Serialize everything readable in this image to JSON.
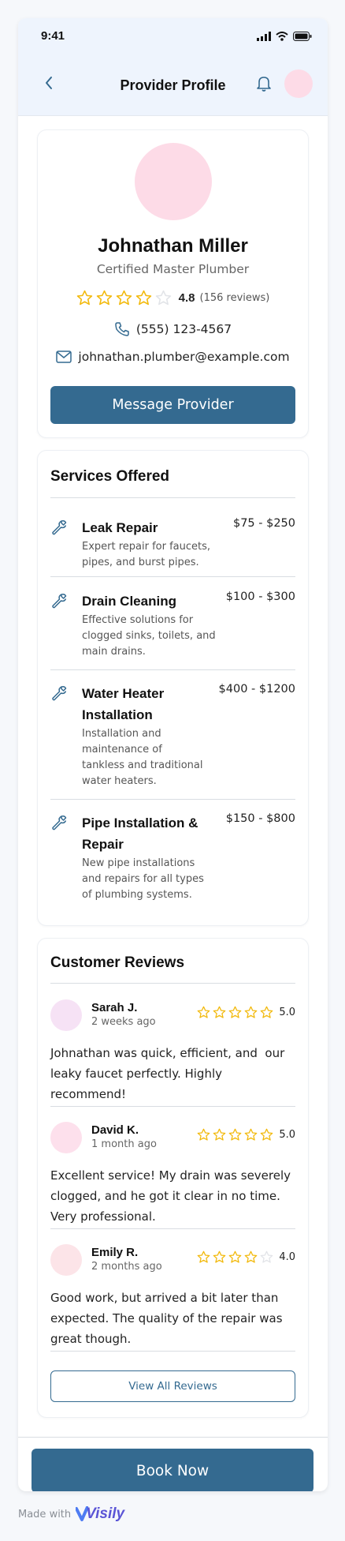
{
  "status_bar": {
    "time": "9:41"
  },
  "header": {
    "title": "Provider Profile"
  },
  "profile": {
    "name": "Johnathan Miller",
    "title": "Certified Master Plumber",
    "rating": "4.8",
    "rating_value": 4,
    "reviews_count": "(156 reviews)",
    "phone": "(555) 123-4567",
    "email": "johnathan.plumber@example.com",
    "message_label": "Message Provider"
  },
  "services": {
    "title": "Services Offered",
    "items": [
      {
        "name_lines": [
          "Leak Repair"
        ],
        "desc_lines": [
          "Expert repair for faucets,",
          "pipes, and burst pipes."
        ],
        "price": "$75 - $250"
      },
      {
        "name_lines": [
          "Drain Cleaning"
        ],
        "desc_lines": [
          "Effective solutions for",
          "clogged sinks, toilets, and",
          "main drains."
        ],
        "price": "$100 - $300"
      },
      {
        "name_lines": [
          "Water Heater",
          "Installation"
        ],
        "desc_lines": [
          "Installation and",
          "maintenance of",
          "tankless and traditional",
          "water heaters."
        ],
        "price": "$400 - $1200"
      },
      {
        "name_lines": [
          "Pipe Installation &",
          "Repair"
        ],
        "desc_lines": [
          "New pipe installations",
          "and repairs for all types",
          "of plumbing systems."
        ],
        "price": "$150 - $800"
      }
    ]
  },
  "reviews": {
    "title": "Customer Reviews",
    "view_all_label": "View All Reviews",
    "items": [
      {
        "name": "Sarah J.",
        "date": "2 weeks ago",
        "score": "5.0",
        "stars": 5,
        "avatar_color": "#f6e2f5",
        "text_lines": [
          "Johnathan was quick, efficient, and  our",
          "leaky faucet perfectly. Highly",
          "recommend!"
        ]
      },
      {
        "name": "David K.",
        "date": "1 month ago",
        "score": "5.0",
        "stars": 5,
        "avatar_color": "#fde0ec",
        "text_lines": [
          "Excellent service! My drain was severely",
          "clogged, and he got it clear in no time.",
          "Very professional."
        ]
      },
      {
        "name": "Emily R.",
        "date": "2 months ago",
        "score": "4.0",
        "stars": 4,
        "avatar_color": "#fce4e8",
        "text_lines": [
          "Good work, but arrived a bit later than",
          "expected. The quality of the repair was",
          "great though."
        ]
      }
    ]
  },
  "footer": {
    "book_label": "Book Now"
  },
  "watermark": {
    "made_with": "Made with",
    "brand": "Visily"
  },
  "colors": {
    "primary": "#346a90",
    "star": "#f2b90c",
    "header_bg": "#eef4fd",
    "avatar_pink": "#fddbe7"
  }
}
